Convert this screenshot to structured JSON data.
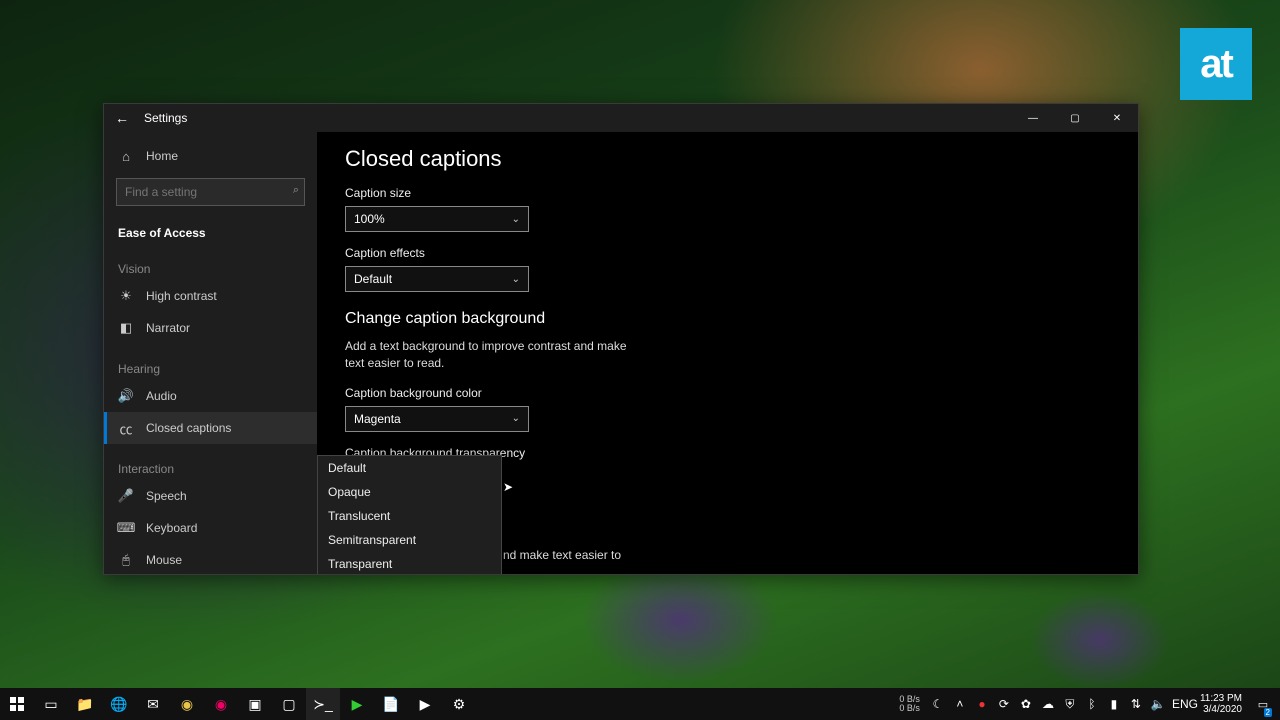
{
  "logo": "at",
  "window": {
    "title": "Settings",
    "controls": {
      "min": "—",
      "max": "▢",
      "close": "✕"
    }
  },
  "sidebar": {
    "home": "Home",
    "search_placeholder": "Find a setting",
    "category": "Ease of Access",
    "groups": [
      {
        "label": "Vision",
        "items": [
          {
            "icon": "contrast",
            "label": "High contrast"
          },
          {
            "icon": "narrator",
            "label": "Narrator"
          }
        ]
      },
      {
        "label": "Hearing",
        "items": [
          {
            "icon": "audio",
            "label": "Audio"
          },
          {
            "icon": "cc",
            "label": "Closed captions",
            "active": true
          }
        ]
      },
      {
        "label": "Interaction",
        "items": [
          {
            "icon": "speech",
            "label": "Speech"
          },
          {
            "icon": "keyboard",
            "label": "Keyboard"
          },
          {
            "icon": "mouse",
            "label": "Mouse"
          }
        ]
      }
    ]
  },
  "content": {
    "page_title": "Closed captions",
    "caption_size": {
      "label": "Caption size",
      "value": "100%"
    },
    "caption_effects": {
      "label": "Caption effects",
      "value": "Default"
    },
    "bg_section": {
      "title": "Change caption background",
      "desc": "Add a text background to improve contrast and make text easier to read."
    },
    "bg_color": {
      "label": "Caption background color",
      "value": "Magenta"
    },
    "bg_trans": {
      "label": "Caption background transparency",
      "options": [
        "Default",
        "Opaque",
        "Translucent",
        "Semitransparent",
        "Transparent"
      ]
    },
    "peek_text": "nd make text easier to"
  },
  "taskbar": {
    "net": {
      "up": "0 B/s",
      "down": "0 B/s"
    },
    "lang": "ENG",
    "time": "11:23 PM",
    "date": "3/4/2020"
  }
}
